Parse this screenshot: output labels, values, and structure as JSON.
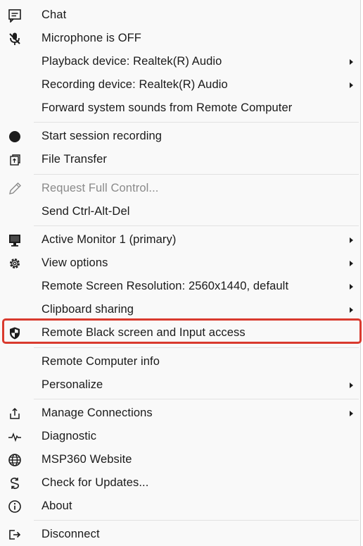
{
  "menu": {
    "items": [
      {
        "label": "Chat",
        "icon": "chat-icon"
      },
      {
        "label": "Microphone is OFF",
        "icon": "microphone-off-icon"
      },
      {
        "label": "Playback device: Realtek(R) Audio",
        "submenu": true
      },
      {
        "label": "Recording device: Realtek(R) Audio",
        "submenu": true
      },
      {
        "label": "Forward system sounds from Remote Computer"
      },
      {
        "label": "Start session recording",
        "icon": "record-icon"
      },
      {
        "label": "File Transfer",
        "icon": "file-transfer-icon"
      },
      {
        "label": "Request Full Control...",
        "icon": "pencil-icon",
        "disabled": true
      },
      {
        "label": "Send Ctrl-Alt-Del"
      },
      {
        "label": "Active Monitor 1 (primary)",
        "icon": "monitor-icon",
        "submenu": true
      },
      {
        "label": "View options",
        "icon": "gear-icon",
        "submenu": true
      },
      {
        "label": "Remote Screen Resolution: 2560x1440, default",
        "submenu": true
      },
      {
        "label": "Clipboard sharing",
        "submenu": true
      },
      {
        "label": "Remote Black screen and Input access",
        "icon": "shield-icon",
        "highlighted": true
      },
      {
        "label": "Remote Computer info"
      },
      {
        "label": "Personalize",
        "submenu": true
      },
      {
        "label": "Manage Connections",
        "icon": "connections-icon",
        "submenu": true
      },
      {
        "label": "Diagnostic",
        "icon": "pulse-icon"
      },
      {
        "label": "MSP360 Website",
        "icon": "globe-icon"
      },
      {
        "label": "Check for Updates...",
        "icon": "update-icon"
      },
      {
        "label": "About",
        "icon": "info-icon"
      },
      {
        "label": "Disconnect",
        "icon": "disconnect-icon"
      }
    ]
  },
  "colors": {
    "highlight_border": "#d93a2e",
    "disabled_text": "#8a8a8a",
    "menu_background": "#f9f9f9"
  }
}
